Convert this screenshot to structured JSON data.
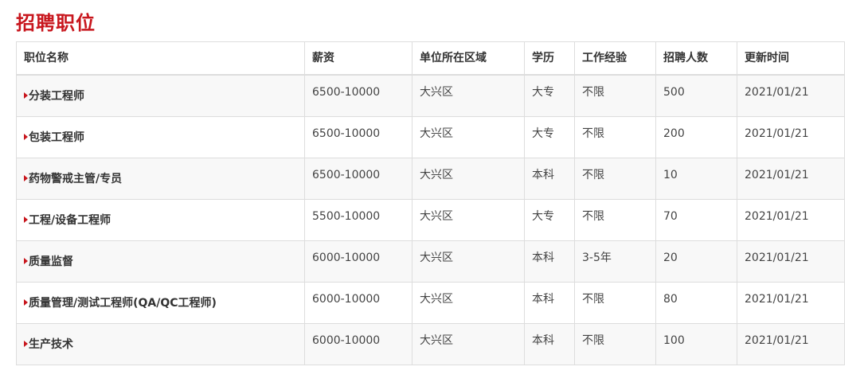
{
  "page": {
    "title": "招聘职位"
  },
  "table": {
    "headers": [
      "职位名称",
      "薪资",
      "单位所在区域",
      "学历",
      "工作经验",
      "招聘人数",
      "更新时间"
    ],
    "rows": [
      {
        "name": "分装工程师",
        "salary": "6500-10000",
        "area": "大兴区",
        "education": "大专",
        "experience": "不限",
        "count": "500",
        "updated": "2021/01/21"
      },
      {
        "name": "包装工程师",
        "salary": "6500-10000",
        "area": "大兴区",
        "education": "大专",
        "experience": "不限",
        "count": "200",
        "updated": "2021/01/21"
      },
      {
        "name": "药物警戒主管/专员",
        "salary": "6500-10000",
        "area": "大兴区",
        "education": "本科",
        "experience": "不限",
        "count": "10",
        "updated": "2021/01/21"
      },
      {
        "name": "工程/设备工程师",
        "salary": "5500-10000",
        "area": "大兴区",
        "education": "大专",
        "experience": "不限",
        "count": "70",
        "updated": "2021/01/21"
      },
      {
        "name": "质量监督",
        "salary": "6000-10000",
        "area": "大兴区",
        "education": "本科",
        "experience": "3-5年",
        "count": "20",
        "updated": "2021/01/21"
      },
      {
        "name": "质量管理/测试工程师(QA/QC工程师)",
        "salary": "6000-10000",
        "area": "大兴区",
        "education": "本科",
        "experience": "不限",
        "count": "80",
        "updated": "2021/01/21"
      },
      {
        "name": "生产技术",
        "salary": "6000-10000",
        "area": "大兴区",
        "education": "本科",
        "experience": "不限",
        "count": "100",
        "updated": "2021/01/21"
      }
    ]
  },
  "icons": {
    "row_marker": "arrow-right-icon"
  },
  "colors": {
    "title": "#c8161d",
    "marker": "#c8161d",
    "stripe": "#f8f8f8",
    "border": "#dddddd"
  }
}
